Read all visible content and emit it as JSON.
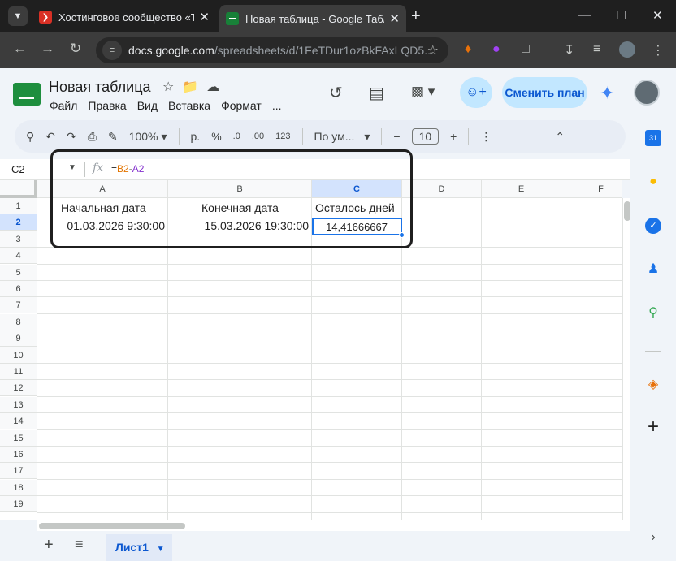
{
  "browser": {
    "tabs": [
      {
        "title": "Хостинговое сообщество «Tim",
        "active": false
      },
      {
        "title": "Новая таблица - Google Табли",
        "active": true
      }
    ],
    "url_domain": "docs.google.com",
    "url_path": "/spreadsheets/d/1FeTDur1ozBkFAxLQD5..."
  },
  "doc": {
    "title": "Новая таблица",
    "menus": [
      "Файл",
      "Правка",
      "Вид",
      "Вставка",
      "Формат",
      "..."
    ],
    "plan_button": "Сменить план"
  },
  "toolbar": {
    "zoom": "100%",
    "currency": "р.",
    "percent": "%",
    "dec_decrease": ".0",
    "dec_increase": ".00",
    "format_123": "123",
    "font": "По ум...",
    "font_size": "10"
  },
  "formula_bar": {
    "cell_ref": "C2",
    "formula_ref1": "B2",
    "formula_op": "-",
    "formula_ref2": "A2"
  },
  "sheet": {
    "columns": [
      "A",
      "B",
      "C",
      "D",
      "E",
      "F"
    ],
    "rows": [
      "1",
      "2",
      "3",
      "4",
      "5",
      "6",
      "7",
      "8",
      "9",
      "10",
      "11",
      "12",
      "13",
      "14",
      "15",
      "16",
      "17",
      "18",
      "19"
    ],
    "cells": {
      "A1": "Начальная дата",
      "B1": "Конечная дата",
      "C1": "Осталось дней",
      "A2": "01.03.2026 9:30:00",
      "B2": "15.03.2026 19:30:00",
      "C2": "14,41666667"
    },
    "tab_name": "Лист1"
  },
  "colors": {
    "accent": "#1a73e8",
    "sheets_green": "#1e8e3e",
    "formula_ref1": "#e37400",
    "formula_ref2": "#8430ce"
  }
}
